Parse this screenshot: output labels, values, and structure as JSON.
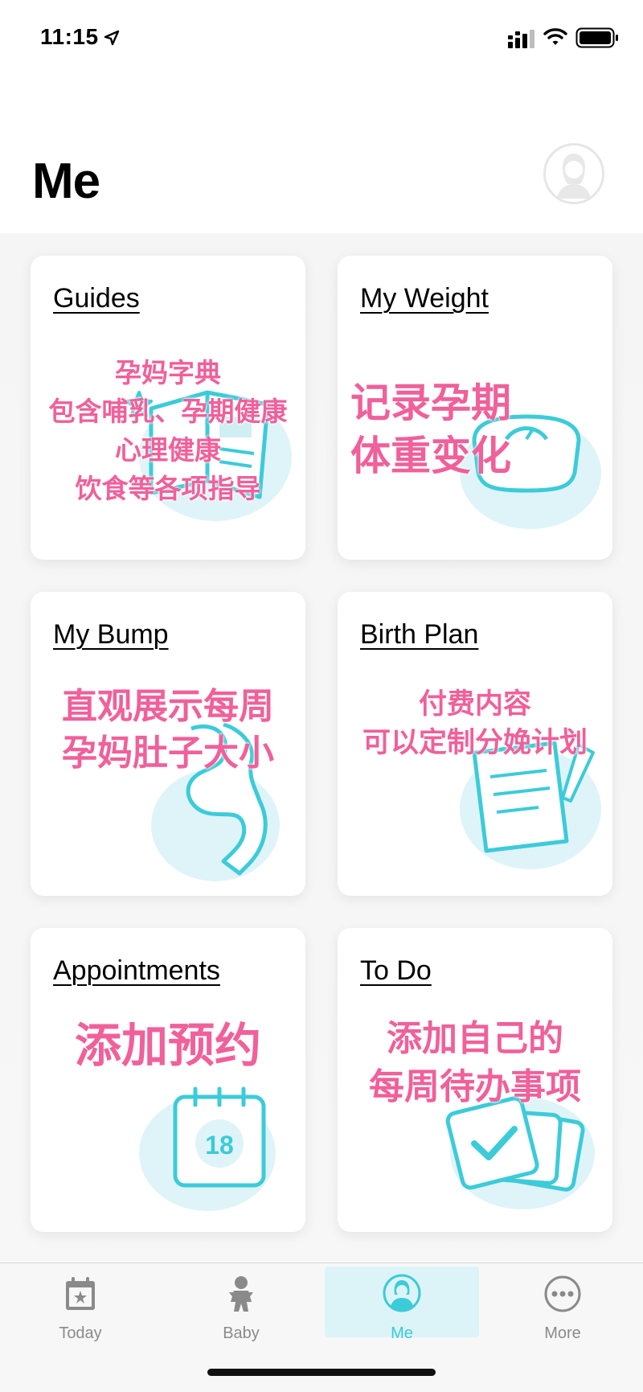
{
  "status": {
    "time": "11:15"
  },
  "page": {
    "title": "Me"
  },
  "cards": [
    {
      "title": "Guides",
      "overlay": [
        "孕妈字典",
        "包含哺乳、孕期健康",
        "心理健康",
        "饮食等各项指导"
      ]
    },
    {
      "title": "My Weight",
      "overlay": [
        "记录孕期",
        "体重变化"
      ]
    },
    {
      "title": "My Bump",
      "overlay": [
        "直观展示每周",
        "孕妈肚子大小"
      ]
    },
    {
      "title": "Birth Plan",
      "overlay": [
        "付费内容",
        "可以定制分娩计划"
      ]
    },
    {
      "title": "Appointments",
      "overlay": [
        "添加预约"
      ],
      "calendar_day": "18"
    },
    {
      "title": "To Do",
      "overlay": [
        "添加自己的",
        "每周待办事项"
      ]
    }
  ],
  "tabs": [
    {
      "label": "Today",
      "icon": "calendar-star-icon"
    },
    {
      "label": "Baby",
      "icon": "baby-icon"
    },
    {
      "label": "Me",
      "icon": "profile-icon",
      "active": true
    },
    {
      "label": "More",
      "icon": "more-icon"
    }
  ],
  "colors": {
    "accent": "#3ccbd9",
    "illustration_bg": "#dff4f8",
    "overlay_text": "#f0609a",
    "tab_inactive": "#8a8a8a"
  }
}
